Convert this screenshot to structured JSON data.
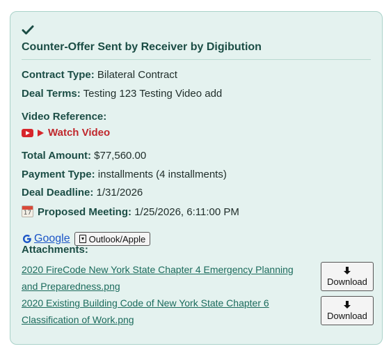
{
  "card": {
    "title": "Counter-Offer Sent by Receiver by Digibution",
    "contract_type_label": "Contract Type:",
    "contract_type_value": "Bilateral Contract",
    "deal_terms_label": "Deal Terms:",
    "deal_terms_value": "Testing 123 Testing Video add",
    "video_reference_label": "Video Reference:",
    "watch_video_label": "Watch Video",
    "total_amount_label": "Total Amount:",
    "total_amount_value": "$77,560.00",
    "payment_type_label": "Payment Type:",
    "payment_type_value": "installments (4 installments)",
    "deal_deadline_label": "Deal Deadline:",
    "deal_deadline_value": "1/31/2026",
    "proposed_meeting_label": "Proposed Meeting:",
    "proposed_meeting_value": "1/25/2026, 6:11:00 PM",
    "calendar_icon_day": "17",
    "google_label": "Google",
    "outlook_label": "Outlook/Apple",
    "attachments_label": "Attachments:",
    "attachments": [
      {
        "name": "2020 FireCode New York State Chapter 4 Emergency Planning and Preparedness.png",
        "button": "Download"
      },
      {
        "name": "2020 Existing Building Code of New York State Chapter 6 Classification of Work.png",
        "button": "Download"
      }
    ]
  },
  "colors": {
    "card_background": "#e4f2ef",
    "accent": "#1b4d45",
    "video_red": "#c0282d",
    "link_blue": "#1a54c7"
  },
  "icons": [
    "check-icon",
    "youtube-icon",
    "play-icon",
    "calendar-icon",
    "google-icon",
    "file-download-icon",
    "download-arrow-icon"
  ]
}
